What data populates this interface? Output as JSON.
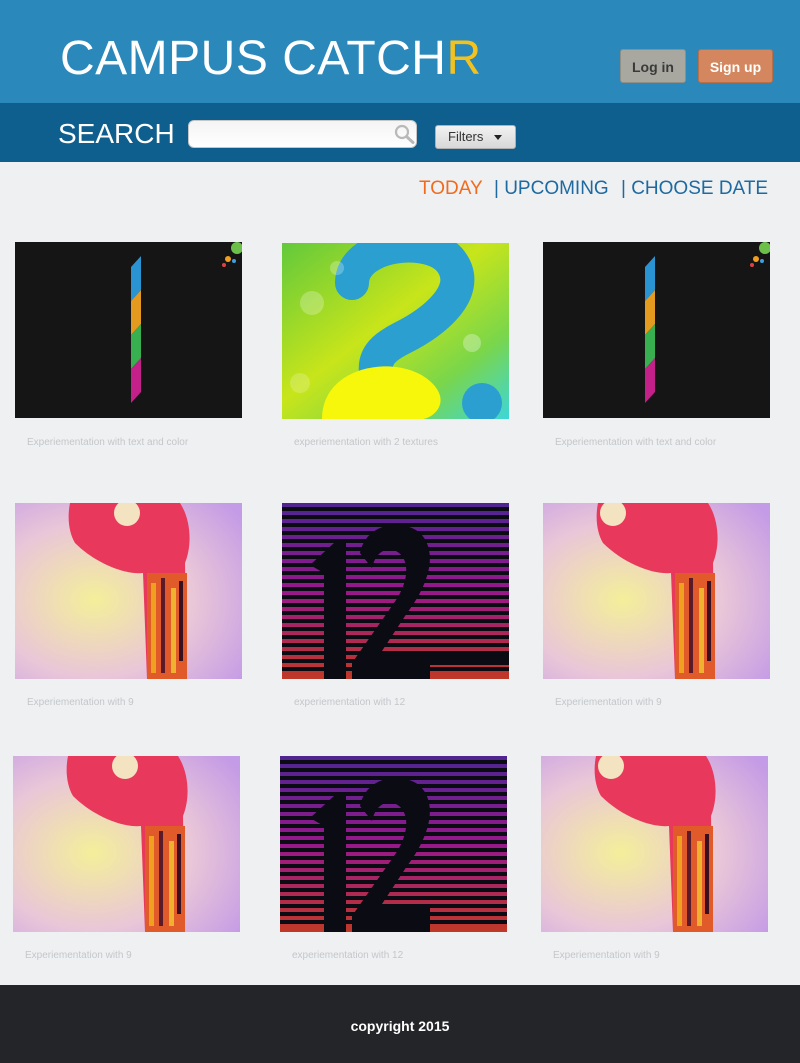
{
  "brand": {
    "name_main": "CAMPUS CATCH",
    "name_accent": "R",
    "accent_color": "#f3c21e"
  },
  "header": {
    "login_label": "Log in",
    "signup_label": "Sign up"
  },
  "search": {
    "label": "SEARCH",
    "value": "",
    "placeholder": "",
    "filters_label": "Filters",
    "icon": "search-icon"
  },
  "nav": {
    "today": "TODAY",
    "upcoming": "| UPCOMING",
    "choose_date": "| CHOOSE DATE"
  },
  "gallery": [
    {
      "art": "stripe-bar",
      "caption": "Experiementation with text and color"
    },
    {
      "art": "green-texture",
      "caption": "experiementation with 2 textures"
    },
    {
      "art": "stripe-bar",
      "caption": "Experiementation with text and color"
    },
    {
      "art": "pink-nine",
      "caption": "Experiementation with 9"
    },
    {
      "art": "twelve-stripes",
      "caption": "experiementation with 12"
    },
    {
      "art": "pink-nine",
      "caption": "Experiementation with 9"
    },
    {
      "art": "pink-nine",
      "caption": "Experiementation with 9"
    },
    {
      "art": "twelve-stripes",
      "caption": "experiementation with 12"
    },
    {
      "art": "pink-nine",
      "caption": "Experiementation with 9"
    }
  ],
  "footer": {
    "copyright": "copyright 2015"
  }
}
